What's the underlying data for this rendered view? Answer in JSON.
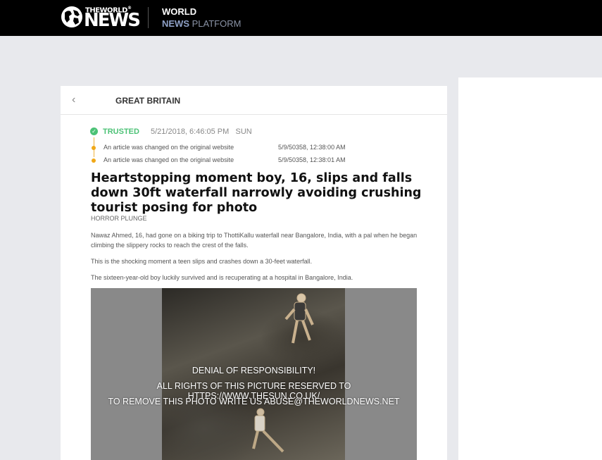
{
  "header": {
    "logo_the": "THE",
    "logo_world": "WORLD",
    "logo_news": "NEWS",
    "platform_line1": "WORLD",
    "platform_news": "NEWS",
    "platform_rest": " PLATFORM"
  },
  "card": {
    "back_icon": "chevron-left-icon",
    "section": "GREAT BRITAIN"
  },
  "status": {
    "label": "TRUSTED",
    "date": "5/21/2018, 6:46:05 PM",
    "source": "SUN",
    "changes": [
      {
        "text": "An article was changed on the original website",
        "date": "5/9/50358, 12:38:00 AM"
      },
      {
        "text": "An article was changed on the original website",
        "date": "5/9/50358, 12:38:01 AM"
      }
    ]
  },
  "article": {
    "headline": "Heartstopping moment boy, 16, slips and falls down 30ft waterfall narrowly avoiding crushing tourist posing for photo",
    "kicker": "HORROR PLUNGE",
    "paragraphs": [
      "Nawaz Ahmed, 16, had gone on a biking trip to ThottiKallu waterfall near Bangalore, India, with a pal when he began climbing the slippery rocks to reach the crest of the falls.",
      "This is the shocking moment a teen slips and crashes down a 30-feet waterfall.",
      "The sixteen-year-old boy luckily survived and is recuperating at a hospital in Bangalore, India."
    ],
    "disclaimer": [
      "DENIAL OF RESPONSIBILITY!",
      "ALL RIGHTS OF THIS PICTURE RESERVED TO HTTPS://WWW.THESUN.CO.UK/",
      "TO REMOVE THIS PHOTO WRITE US ABUSE@THEWORLDNEWS.NET"
    ]
  },
  "colors": {
    "topbar": "#000000",
    "trusted": "#4cc276",
    "change_dot": "#f0a818",
    "background": "#e8e9ed"
  }
}
